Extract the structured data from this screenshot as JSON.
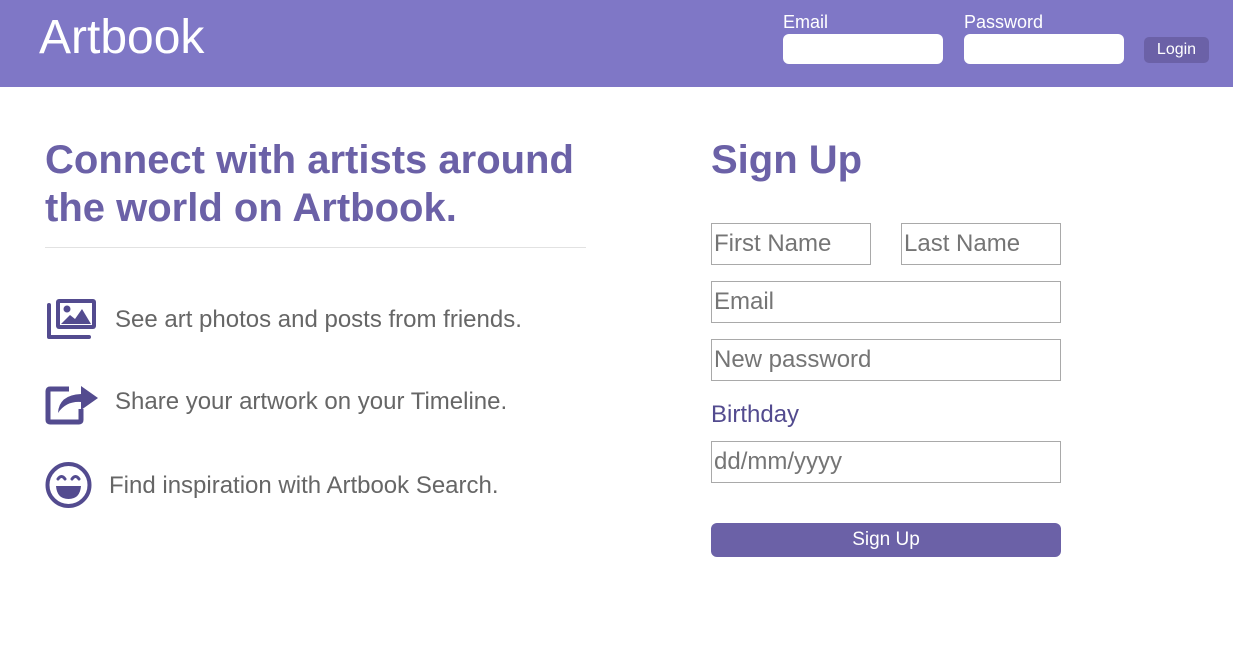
{
  "header": {
    "logo": "Artbook",
    "login": {
      "email_label": "Email",
      "password_label": "Password",
      "email_value": "",
      "password_value": "",
      "button_label": "Login"
    }
  },
  "intro": {
    "headline": "Connect with artists around the world on Artbook.",
    "features": [
      {
        "icon": "photos-icon",
        "text": "See art photos and posts from friends."
      },
      {
        "icon": "share-icon",
        "text": "Share your artwork on your Timeline."
      },
      {
        "icon": "laughing-face-icon",
        "text": "Find inspiration with Artbook Search."
      }
    ]
  },
  "signup": {
    "title": "Sign Up",
    "first_name_placeholder": "First Name",
    "last_name_placeholder": "Last Name",
    "email_placeholder": "Email",
    "password_placeholder": "New password",
    "birthday_label": "Birthday",
    "birthday_placeholder": "dd/mm/yyyy",
    "button_label": "Sign Up"
  },
  "colors": {
    "header_bg": "#7f77c6",
    "accent": "#6b61a7",
    "icon": "#534b8f",
    "text": "#666666"
  }
}
